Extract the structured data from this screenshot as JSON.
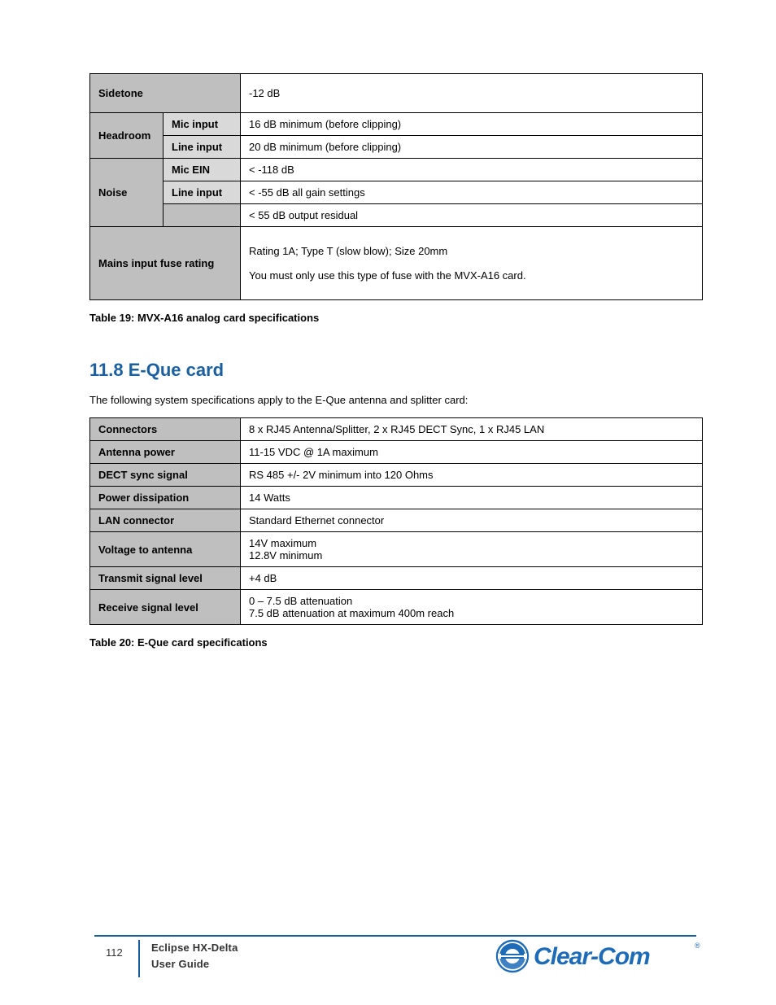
{
  "table1": {
    "r0": {
      "c0": "Sidetone",
      "c1": "-12 dB"
    },
    "r1": {
      "c0": "Headroom",
      "c1a": "Mic input",
      "c2a": "16 dB minimum (before clipping)",
      "c1b": "Line input",
      "c2b": "20 dB minimum (before clipping)"
    },
    "r2": {
      "c0": "Noise",
      "c1a": "Mic EIN",
      "c2a": "< -118 dB",
      "c1b": "Line input",
      "c2b": "< -55 dB all gain settings",
      "c2c": "< 55 dB output residual"
    },
    "r3": {
      "c0": "Mains input fuse rating",
      "c1": "Rating 1A; Type T (slow blow); Size 20mm\n\nYou must only use this type of fuse with the MVX-A16 card."
    },
    "caption": "Table 19: MVX-A16 analog card specifications"
  },
  "section": {
    "title": "11.8 E-Que card",
    "intro": "The following system specifications apply to the E-Que antenna and splitter card:"
  },
  "table2": {
    "r0": {
      "c0": "Connectors",
      "c1": "8 x RJ45 Antenna/Splitter, 2 x RJ45 DECT Sync, 1 x RJ45 LAN"
    },
    "r1": {
      "c0": "Antenna power",
      "c1": "11-15 VDC @ 1A maximum"
    },
    "r2": {
      "c0": "DECT sync signal",
      "c1": "RS 485 +/- 2V minimum into 120 Ohms"
    },
    "r3": {
      "c0": "Power dissipation",
      "c1": "14 Watts"
    },
    "r4": {
      "c0": "LAN connector",
      "c1": "Standard Ethernet connector"
    },
    "r5": {
      "c0": "Voltage to antenna",
      "c1": "14V maximum\n12.8V minimum"
    },
    "r6": {
      "c0": "Transmit signal level",
      "c1": "+4 dB"
    },
    "r7": {
      "c0": "Receive signal level",
      "c1": "0 – 7.5 dB attenuation\n7.5 dB attenuation at maximum 400m reach"
    },
    "caption": "Table 20: E-Que card specifications"
  },
  "footer": {
    "page": "112",
    "doc": "Eclipse HX-Delta",
    "guide": "User Guide"
  },
  "logo": {
    "text": "Clear-Com",
    "reg": "®",
    "name": "clear-com-logo"
  }
}
